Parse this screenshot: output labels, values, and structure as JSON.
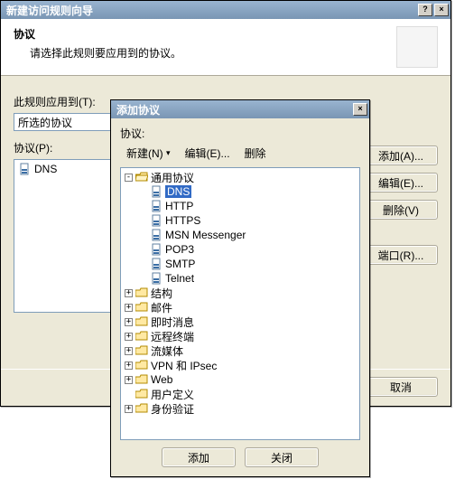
{
  "wiz": {
    "title": "新建访问规则向导",
    "header_title": "协议",
    "header_sub": "请选择此规则要应用到的协议。",
    "apply_label": "此规则应用到(T):",
    "combo_value": "所选的协议",
    "proto_label": "协议(P):",
    "list": [
      {
        "label": "DNS"
      }
    ],
    "btn_add": "添加(A)...",
    "btn_edit": "编辑(E)...",
    "btn_del": "删除(V)",
    "btn_port": "端口(R)...",
    "btn_cancel": "取消"
  },
  "dlg": {
    "title": "添加协议",
    "label": "协议:",
    "tool_new": "新建(N)",
    "tool_edit": "编辑(E)...",
    "tool_del": "删除",
    "root": "通用协议",
    "protos": [
      "DNS",
      "HTTP",
      "HTTPS",
      "MSN Messenger",
      "POP3",
      "SMTP",
      "Telnet"
    ],
    "folders": [
      "结构",
      "邮件",
      "即时消息",
      "远程终端",
      "流媒体",
      "VPN 和 IPsec",
      "Web",
      "用户定义",
      "身份验证"
    ],
    "btn_add": "添加",
    "btn_close": "关闭"
  }
}
